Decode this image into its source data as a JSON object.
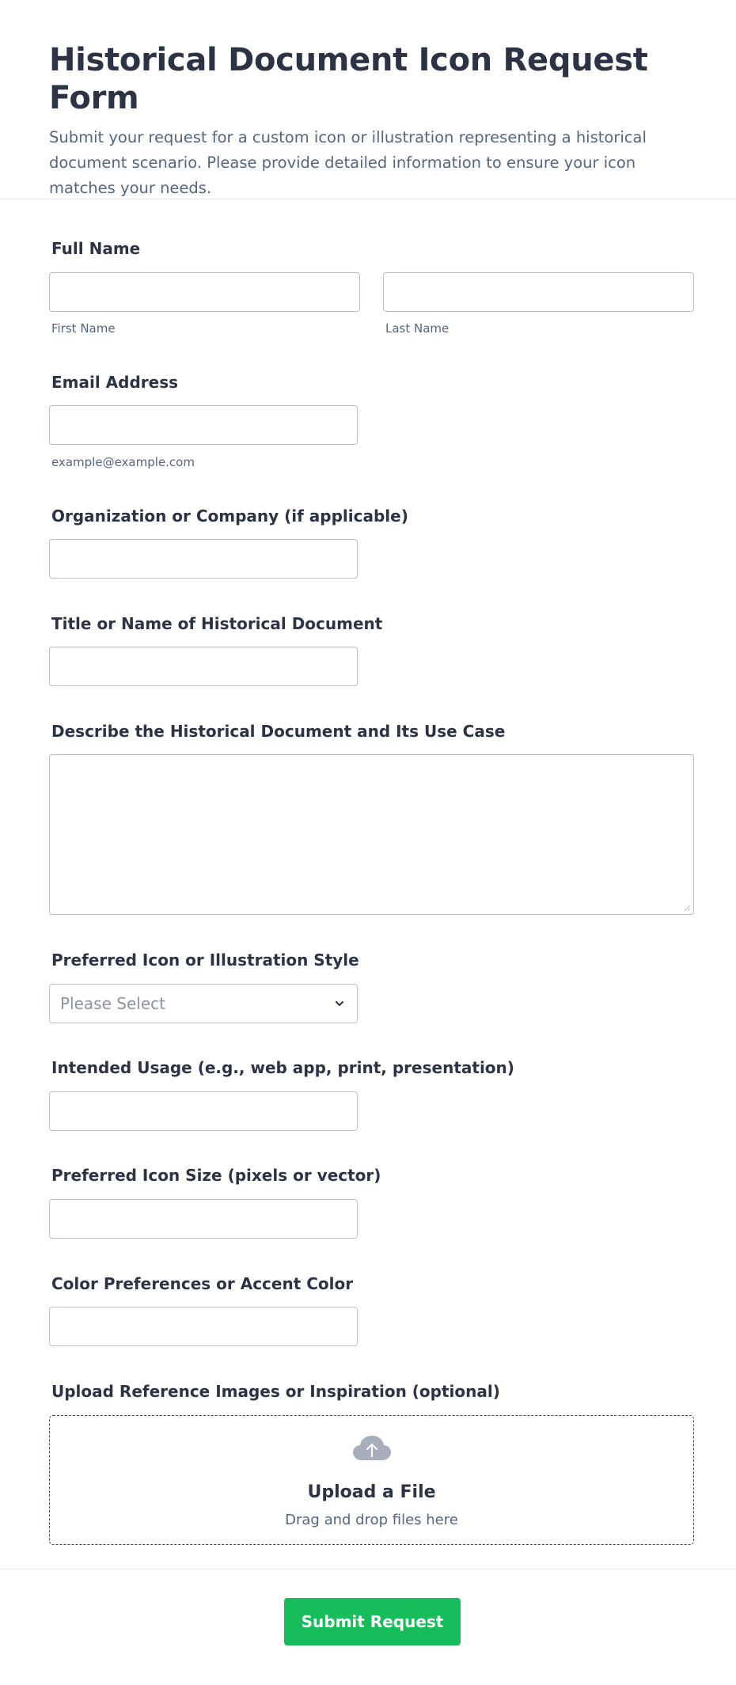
{
  "header": {
    "title": "Historical Document Icon Request Form",
    "description": "Submit your request for a custom icon or illustration representing a historical document scenario. Please provide detailed information to ensure your icon matches your needs."
  },
  "fields": {
    "full_name": {
      "label": "Full Name",
      "first_sublabel": "First Name",
      "last_sublabel": "Last Name",
      "first_value": "",
      "last_value": ""
    },
    "email": {
      "label": "Email Address",
      "sublabel": "example@example.com",
      "value": ""
    },
    "organization": {
      "label": "Organization or Company (if applicable)",
      "value": ""
    },
    "document_title": {
      "label": "Title or Name of Historical Document",
      "value": ""
    },
    "description": {
      "label": "Describe the Historical Document and Its Use Case",
      "value": ""
    },
    "style": {
      "label": "Preferred Icon or Illustration Style",
      "placeholder": "Please Select"
    },
    "usage": {
      "label": "Intended Usage (e.g., web app, print, presentation)",
      "value": ""
    },
    "size": {
      "label": "Preferred Icon Size (pixels or vector)",
      "value": ""
    },
    "color": {
      "label": "Color Preferences or Accent Color",
      "value": ""
    },
    "upload": {
      "label": "Upload Reference Images or Inspiration (optional)",
      "title": "Upload a File",
      "hint": "Drag and drop files here",
      "icon": "cloud-upload-icon"
    }
  },
  "submit": {
    "label": "Submit Request",
    "color": "#18bd5b"
  },
  "colors": {
    "text": "#2c3345",
    "muted": "#57647e",
    "border": "#b8bdc9"
  }
}
